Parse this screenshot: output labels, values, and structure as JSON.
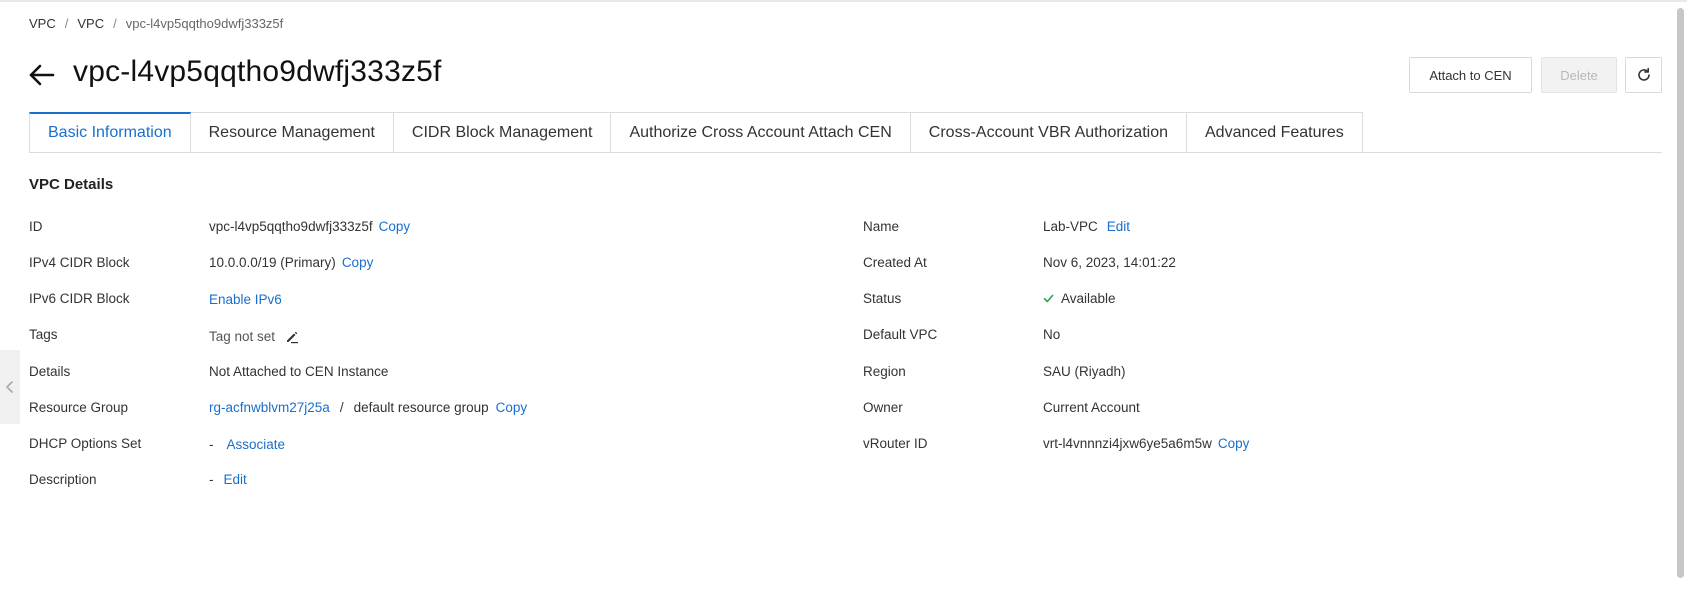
{
  "breadcrumb": {
    "item1": "VPC",
    "item2": "VPC",
    "current": "vpc-l4vp5qqtho9dwfj333z5f",
    "sep": "/"
  },
  "header": {
    "title": "vpc-l4vp5qqtho9dwfj333z5f"
  },
  "actions": {
    "attach": "Attach to CEN",
    "delete": "Delete"
  },
  "tabs": [
    {
      "label": "Basic Information"
    },
    {
      "label": "Resource Management"
    },
    {
      "label": "CIDR Block Management"
    },
    {
      "label": "Authorize Cross Account Attach CEN"
    },
    {
      "label": "Cross-Account VBR Authorization"
    },
    {
      "label": "Advanced Features"
    }
  ],
  "section": {
    "title": "VPC Details"
  },
  "left": {
    "id": {
      "label": "ID",
      "value": "vpc-l4vp5qqtho9dwfj333z5f",
      "action": "Copy"
    },
    "ipv4": {
      "label": "IPv4 CIDR Block",
      "value": "10.0.0.0/19 (Primary)",
      "action": "Copy"
    },
    "ipv6": {
      "label": "IPv6 CIDR Block",
      "action": "Enable IPv6"
    },
    "tags": {
      "label": "Tags",
      "value": "Tag not set"
    },
    "details": {
      "label": "Details",
      "value": "Not Attached to CEN Instance"
    },
    "rg": {
      "label": "Resource Group",
      "id": "rg-acfnwblvm27j25a",
      "sep": "/",
      "name": "default resource group",
      "action": "Copy"
    },
    "dhcp": {
      "label": "DHCP Options Set",
      "value": "-",
      "action": "Associate"
    },
    "desc": {
      "label": "Description",
      "value": "-",
      "action": "Edit"
    }
  },
  "right": {
    "name": {
      "label": "Name",
      "value": "Lab-VPC",
      "action": "Edit"
    },
    "created": {
      "label": "Created At",
      "value": "Nov 6, 2023, 14:01:22"
    },
    "status": {
      "label": "Status",
      "value": "Available"
    },
    "default_vpc": {
      "label": "Default VPC",
      "value": "No"
    },
    "region": {
      "label": "Region",
      "value": "SAU (Riyadh)"
    },
    "owner": {
      "label": "Owner",
      "value": "Current Account"
    },
    "vrouter": {
      "label": "vRouter ID",
      "value": "vrt-l4vnnnzi4jxw6ye5a6m5w",
      "action": "Copy"
    }
  },
  "colors": {
    "link": "#1a6fcc",
    "status_ok": "#2ba24c",
    "disabled_bg": "#f2f2f2"
  },
  "icons": {
    "back": "arrow-left-icon",
    "refresh": "refresh-icon",
    "edit": "pencil-icon",
    "status": "check-icon",
    "side": "chevron-left-icon"
  }
}
